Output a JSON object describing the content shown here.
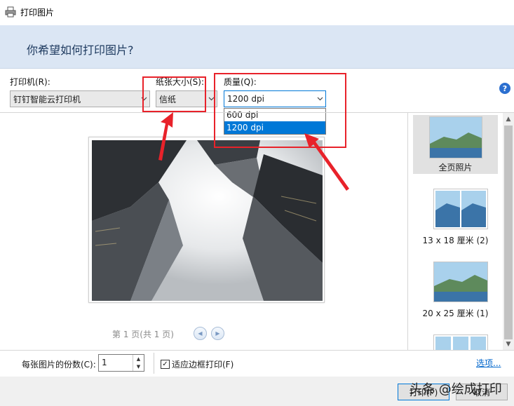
{
  "window": {
    "title": "打印图片"
  },
  "banner": {
    "heading": "你希望如何打印图片?"
  },
  "printer": {
    "label": "打印机(R):",
    "value": "钉钉智能云打印机"
  },
  "paper_size": {
    "label": "纸张大小(S):",
    "value": "信纸"
  },
  "quality": {
    "label": "质量(Q):",
    "value": "1200 dpi",
    "options": [
      "600 dpi",
      "1200 dpi"
    ],
    "selected_index": 1
  },
  "help": {
    "glyph": "?"
  },
  "preview": {
    "pager_text": "第 1 页(共 1 页)",
    "prev_glyph": "◀",
    "next_glyph": "▶"
  },
  "layouts": [
    {
      "label": "全页照片",
      "selected": true
    },
    {
      "label": "13 x 18 厘米 (2)",
      "selected": false
    },
    {
      "label": "20 x 25 厘米 (1)",
      "selected": false
    }
  ],
  "scrollbar": {
    "up_glyph": "▲",
    "down_glyph": "▼"
  },
  "copies": {
    "label": "每张图片的份数(C):",
    "value": "1",
    "up_glyph": "▲",
    "down_glyph": "▼"
  },
  "fit": {
    "label": "适应边框打印(F)",
    "checked": true,
    "check_glyph": "✓"
  },
  "options_link": "选项...",
  "buttons": {
    "print": "打印(P)",
    "cancel": "取消"
  },
  "watermark": "头条 @绘成打印",
  "colors": {
    "accent": "#0078d7",
    "banner": "#dbe6f4",
    "annotation": "#e8222a"
  },
  "icons": [
    "printer-icon",
    "help-icon",
    "chevron-down-icon",
    "prev-page-icon",
    "next-page-icon"
  ]
}
